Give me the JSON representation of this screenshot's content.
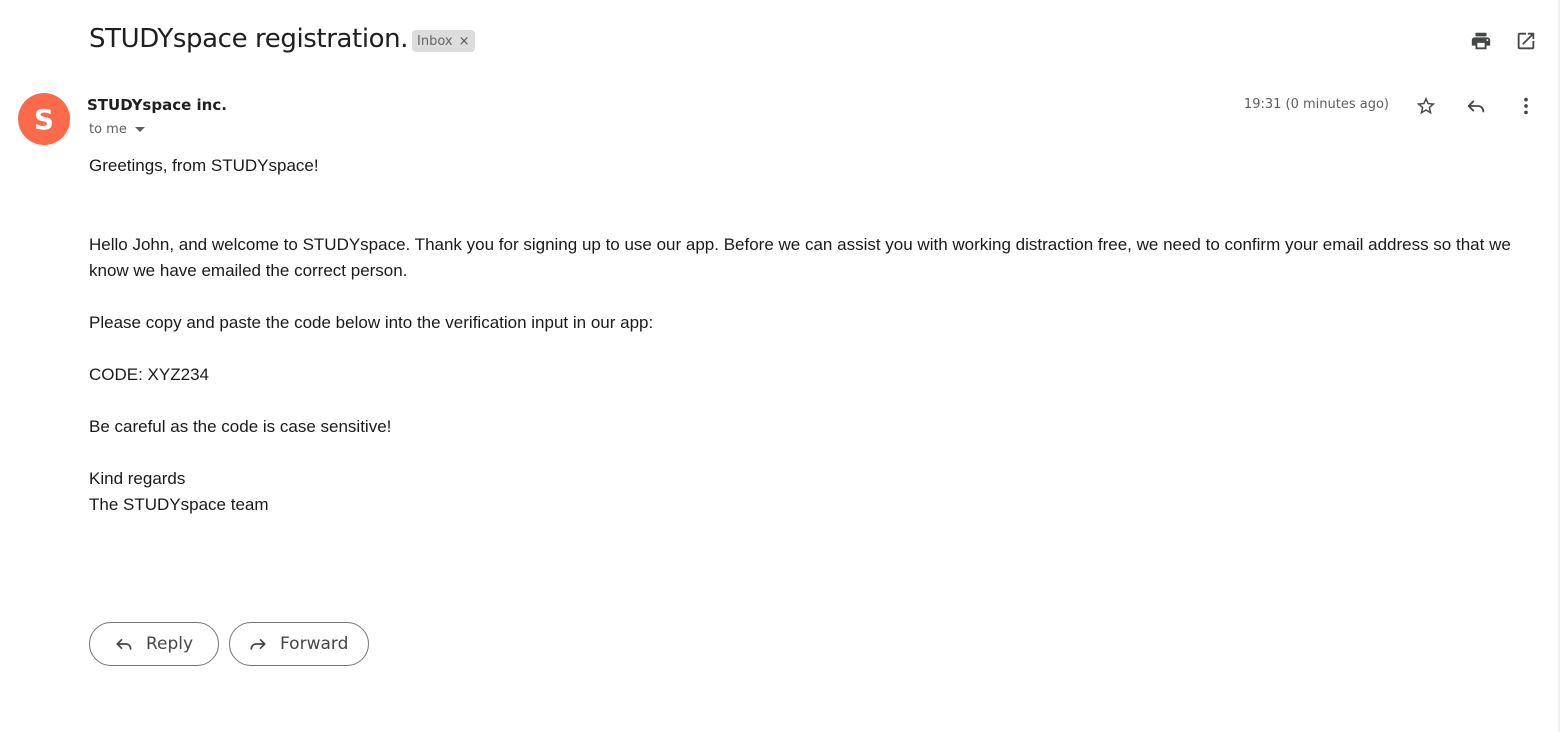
{
  "email": {
    "subject": "STUDYspace registration.",
    "label_chip": {
      "text": "Inbox",
      "remove_symbol": "×"
    },
    "sender": {
      "avatar_letter": "S",
      "avatar_color": "#fc6a4b",
      "name": "STUDYspace inc.",
      "recipient": "to me",
      "timestamp": "19:31 (0 minutes ago)"
    },
    "body": {
      "greeting": "Greetings, from STUDYspace!",
      "intro": "Hello John, and welcome to STUDYspace. Thank you for signing up to use our app. Before we can assist you with working distraction free, we need to confirm your email address so that we know we have emailed the correct person.",
      "instruction": "Please copy and paste the code below into the verification input in our app:",
      "code": "CODE: XYZ234",
      "warning": "Be careful as the code is case sensitive!",
      "signoff": "Kind regards",
      "signature": "The STUDYspace team"
    },
    "actions": {
      "reply_label": "Reply",
      "forward_label": "Forward"
    }
  },
  "icons": {
    "print": "print-icon",
    "open_new_window": "open-in-new-icon",
    "star": "star-icon",
    "reply": "reply-icon",
    "more": "more-vert-icon",
    "forward": "forward-icon"
  }
}
